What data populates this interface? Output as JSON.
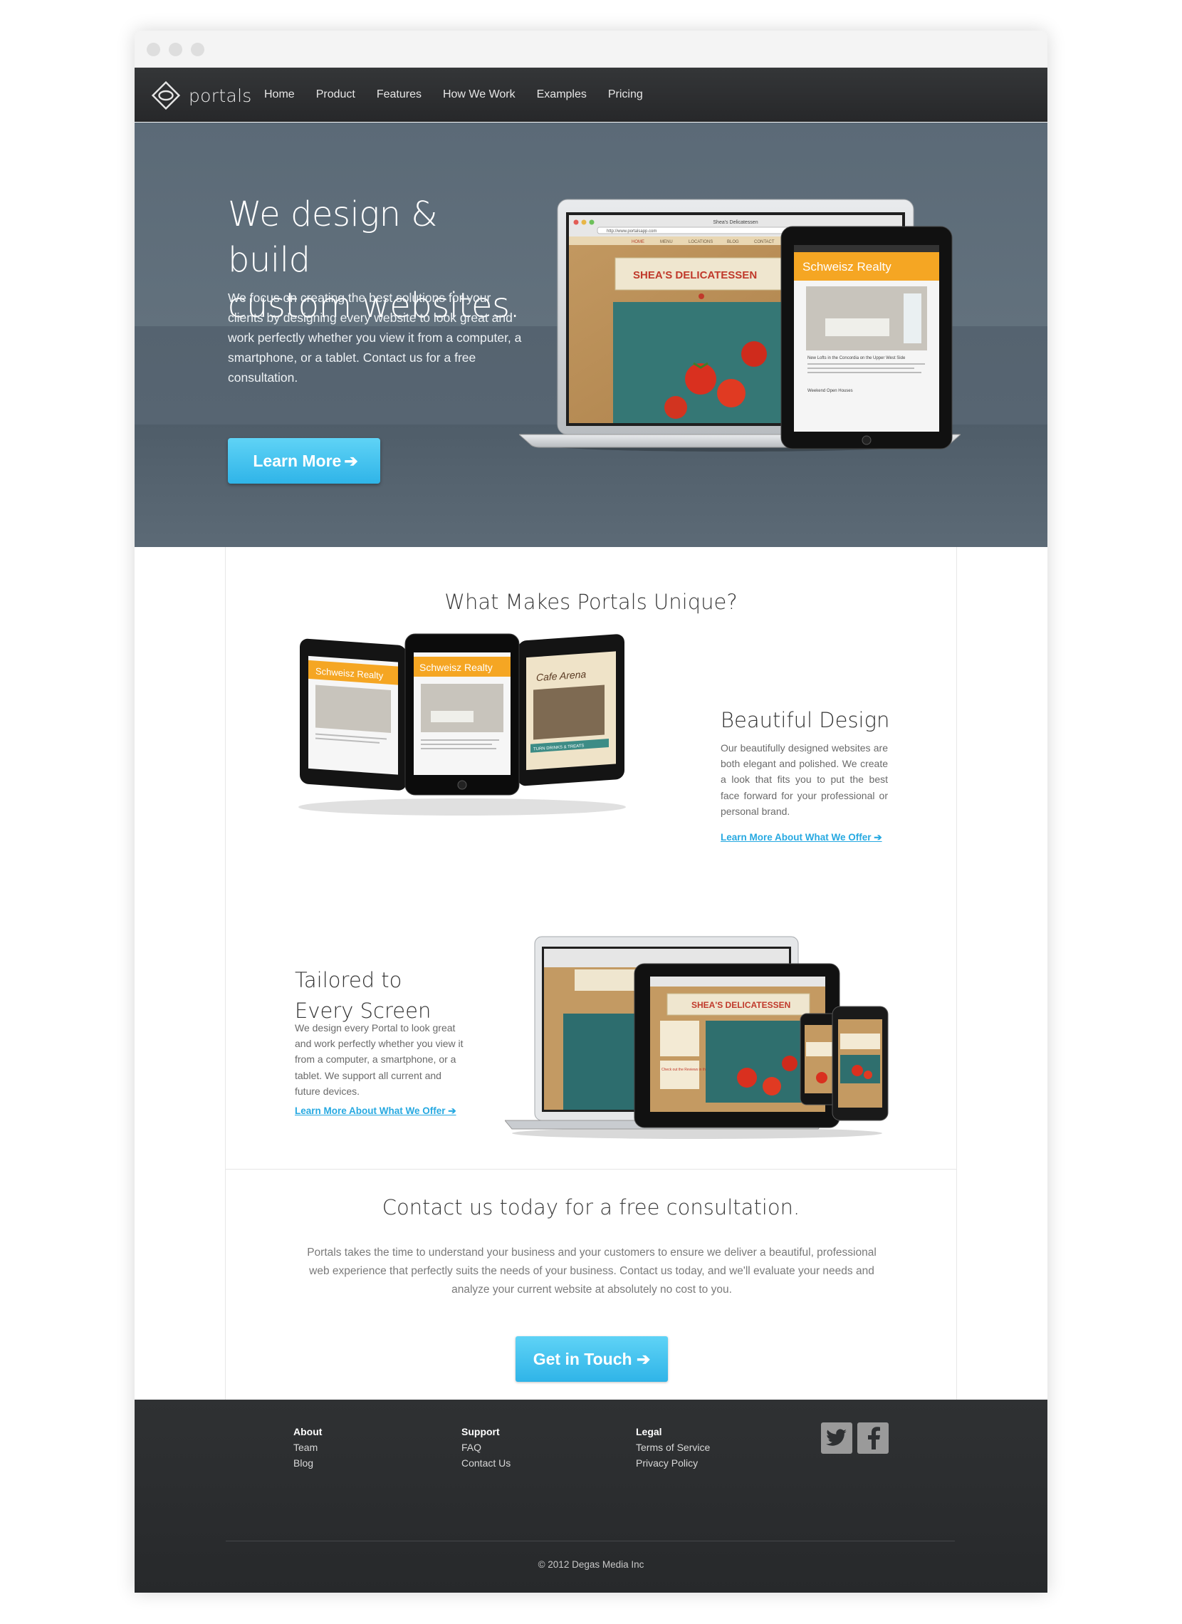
{
  "brand": {
    "name": "portals"
  },
  "nav": {
    "items": [
      "Home",
      "Product",
      "Features",
      "How We Work",
      "Examples",
      "Pricing"
    ]
  },
  "hero": {
    "title_line1": "We design & build",
    "title_line2": "custom websites.",
    "body": "We focus on creating the best solutions for your clients by designing every website to look great and work perfectly whether you view it from a computer, a smartphone, or a tablet. Contact us for a free consultation.",
    "button_label": "Learn More",
    "button_arrow": "➔"
  },
  "mockups": {
    "browser_title": "Shea's Delicatessen",
    "url": "http://www.portalsapp.com",
    "deli_nav": [
      "HOME",
      "MENU",
      "LOCATIONS",
      "BLOG",
      "CONTACT"
    ],
    "deli_banner": "SHEA'S DELICATESSEN",
    "realty_name": "Schweisz Realty",
    "listing_title": "New Lofts in the Concordia on the Upper West Side",
    "listing_title2": "Weekend Open Houses",
    "cafe_name": "Cafe Arena",
    "cafe_banner": "TURN DRINKS & TREATS",
    "deli_callout": "Check out the Reviews in the Seattle Times!"
  },
  "unique": {
    "heading": "What Makes Portals Unique?",
    "feature1": {
      "title": "Beautiful Design",
      "body": "Our beautifully designed websites are both elegant and polished. We create a look that fits you to put the best face forward for your professional or personal brand.",
      "link": "Learn More About What We Offer ➔"
    },
    "feature2": {
      "title_line1": "Tailored to",
      "title_line2": "Every Screen",
      "body": "We design every Portal to look great and work perfectly whether you view it from a computer, a smartphone, or a tablet. We support all current and future devices.",
      "link": "Learn More About What We Offer ➔"
    }
  },
  "cta": {
    "heading": "Contact us today for a free consultation.",
    "body": "Portals takes the time to understand your business and your customers to ensure we deliver a beautiful, professional web experience that perfectly suits the needs of your business. Contact us today, and we'll evaluate your needs and analyze your current website at absolutely no cost to you.",
    "button_label": "Get in Touch ➔"
  },
  "footer": {
    "about": {
      "heading": "About",
      "links": [
        "Team",
        "Blog"
      ]
    },
    "support": {
      "heading": "Support",
      "links": [
        "FAQ",
        "Contact Us"
      ]
    },
    "legal": {
      "heading": "Legal",
      "links": [
        "Terms of Service",
        "Privacy Policy"
      ]
    },
    "social": [
      "twitter-icon",
      "facebook-icon"
    ],
    "copyright": "© 2012 Degas Media Inc"
  },
  "colors": {
    "accent": "#2fb4e8",
    "hero_bg": "#5b6a77",
    "nav_bg": "#2e3032",
    "footer_bg": "#2b2d2f",
    "realty_orange": "#f5a623",
    "deli_red": "#c0392b"
  }
}
